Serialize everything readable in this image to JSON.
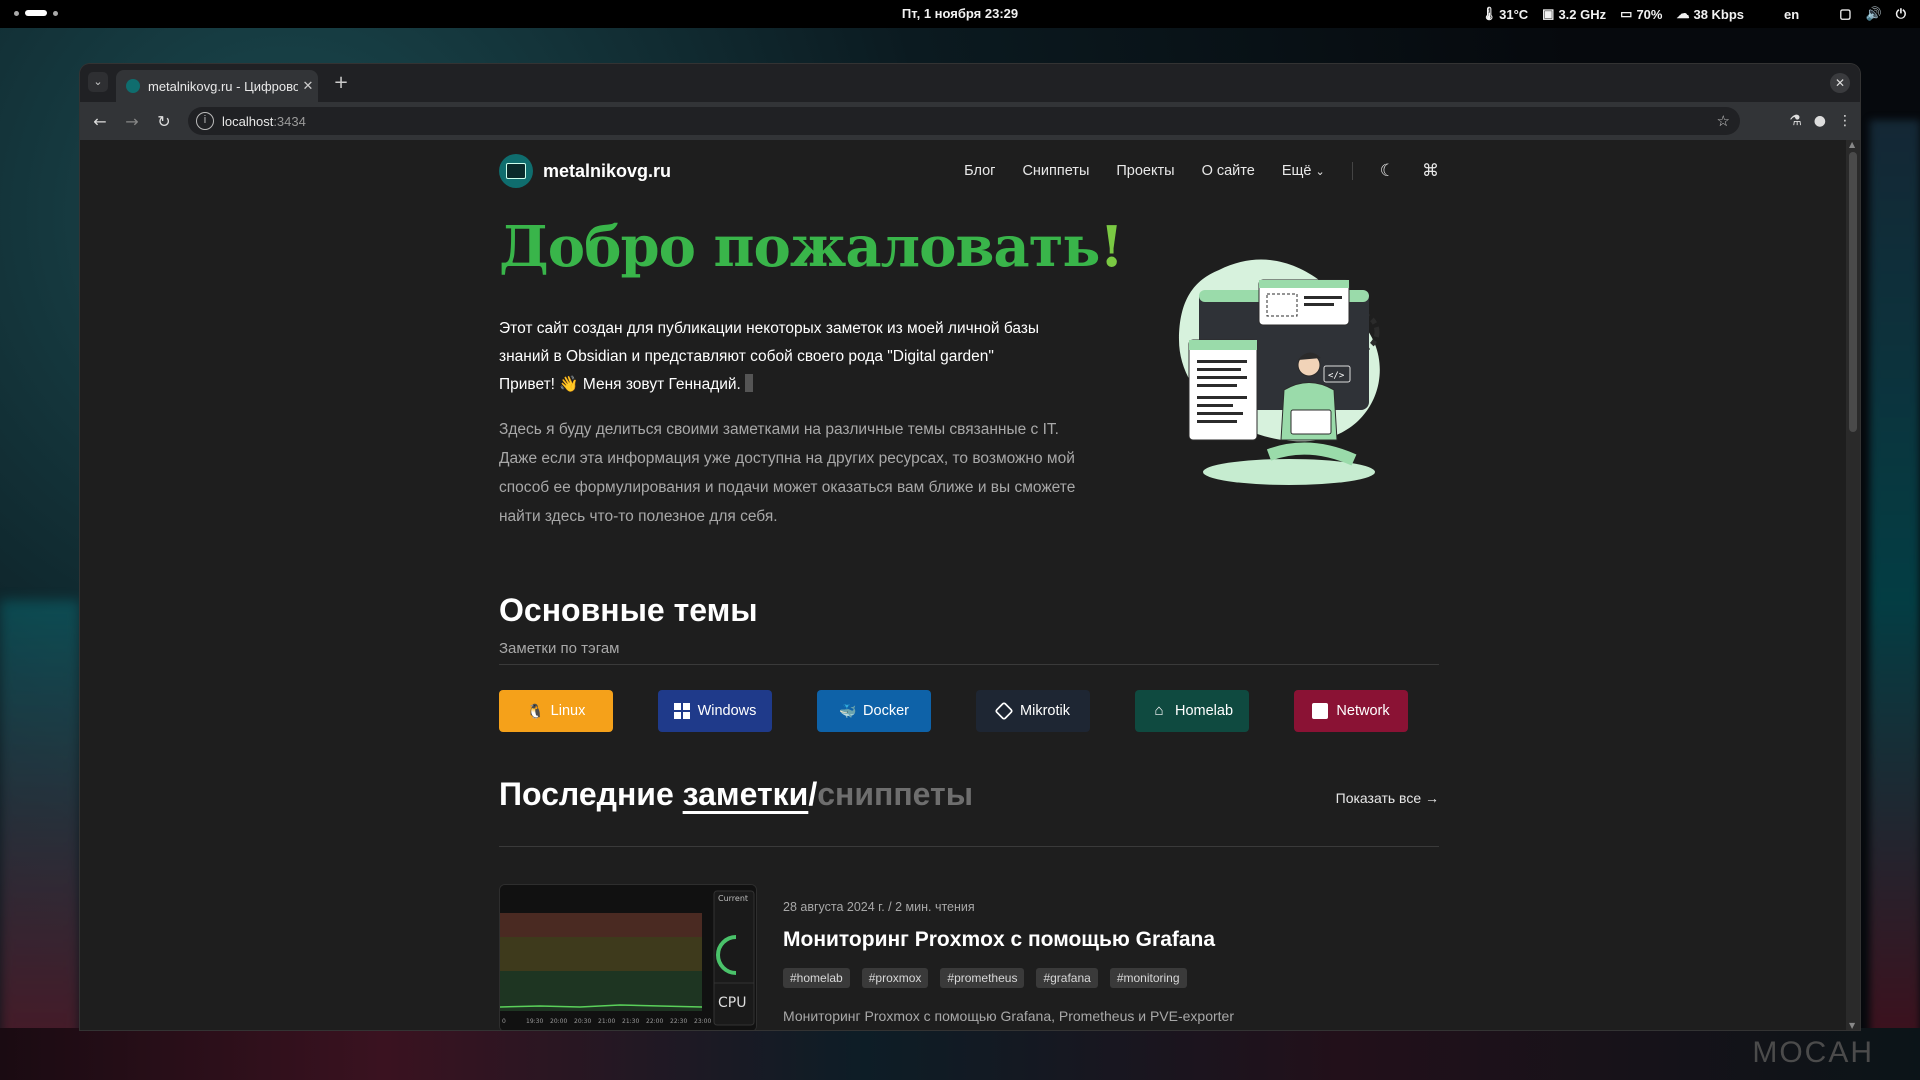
{
  "topbar": {
    "clock": "Пт, 1 ноября  23:29",
    "temp": "31°C",
    "cpu_freq": "3.2 GHz",
    "battery": "70%",
    "net": "38 Kbps",
    "lang": "en"
  },
  "browser": {
    "tab_title": "metalnikovg.ru - Цифровой сад",
    "url_host": "localhost",
    "url_port": ":3434"
  },
  "site": {
    "logo_text": "metalnikovg.ru",
    "nav": [
      "Блог",
      "Сниппеты",
      "Проекты",
      "О сайте",
      "Ещё"
    ],
    "hero_title": "Добро пожаловать",
    "hero_mark": "!",
    "intro_1": "Этот сайт создан для публикации некоторых заметок из моей личной базы знаний в Obsidian и представляют собой своего рода \"Digital garden\"",
    "intro_greeting": "Привет! 👋 Меня зовут Геннадий.",
    "intro_2": "Здесь я буду делиться своими заметками на различные темы связанные с IT. Даже если эта информация уже доступна на других ресурсах, то возможно мой способ ее формулирования и подачи может оказаться вам ближе и вы сможете найти здесь что-то полезное для себя.",
    "topics_title": "Основные темы",
    "topics_sub": "Заметки по тэгам",
    "topics": [
      {
        "label": "Linux",
        "color": "#f5a11a"
      },
      {
        "label": "Windows",
        "color": "#1f3a8a"
      },
      {
        "label": "Docker",
        "color": "#0e62a8"
      },
      {
        "label": "Mikrotik",
        "color": "#1e2633"
      },
      {
        "label": "Homelab",
        "color": "#0f4a40"
      },
      {
        "label": "Network",
        "color": "#8a1234"
      }
    ],
    "latest_prefix": "Последние",
    "latest_notes": "заметки",
    "latest_slash": "/",
    "latest_snippets": "сниппеты",
    "show_all": "Показать все →",
    "post": {
      "meta": "28 августа 2024 г.  /  2 мин. чтения",
      "title": "Мониторинг Proxmox с помощью Grafana",
      "tags": [
        "#homelab",
        "#proxmox",
        "#prometheus",
        "#grafana",
        "#monitoring"
      ],
      "excerpt": "Мониторинг Proxmox с помощью Grafana, Prometheus и PVE-exporter",
      "thumb_label_current": "Current",
      "thumb_label_cpu": "CPU",
      "thumb_times": [
        "0",
        "19:30",
        "20:00",
        "20:30",
        "21:00",
        "21:30",
        "22:00",
        "22:30",
        "23:00"
      ]
    }
  },
  "wallpaper": {
    "watermark": "MOCAH"
  }
}
